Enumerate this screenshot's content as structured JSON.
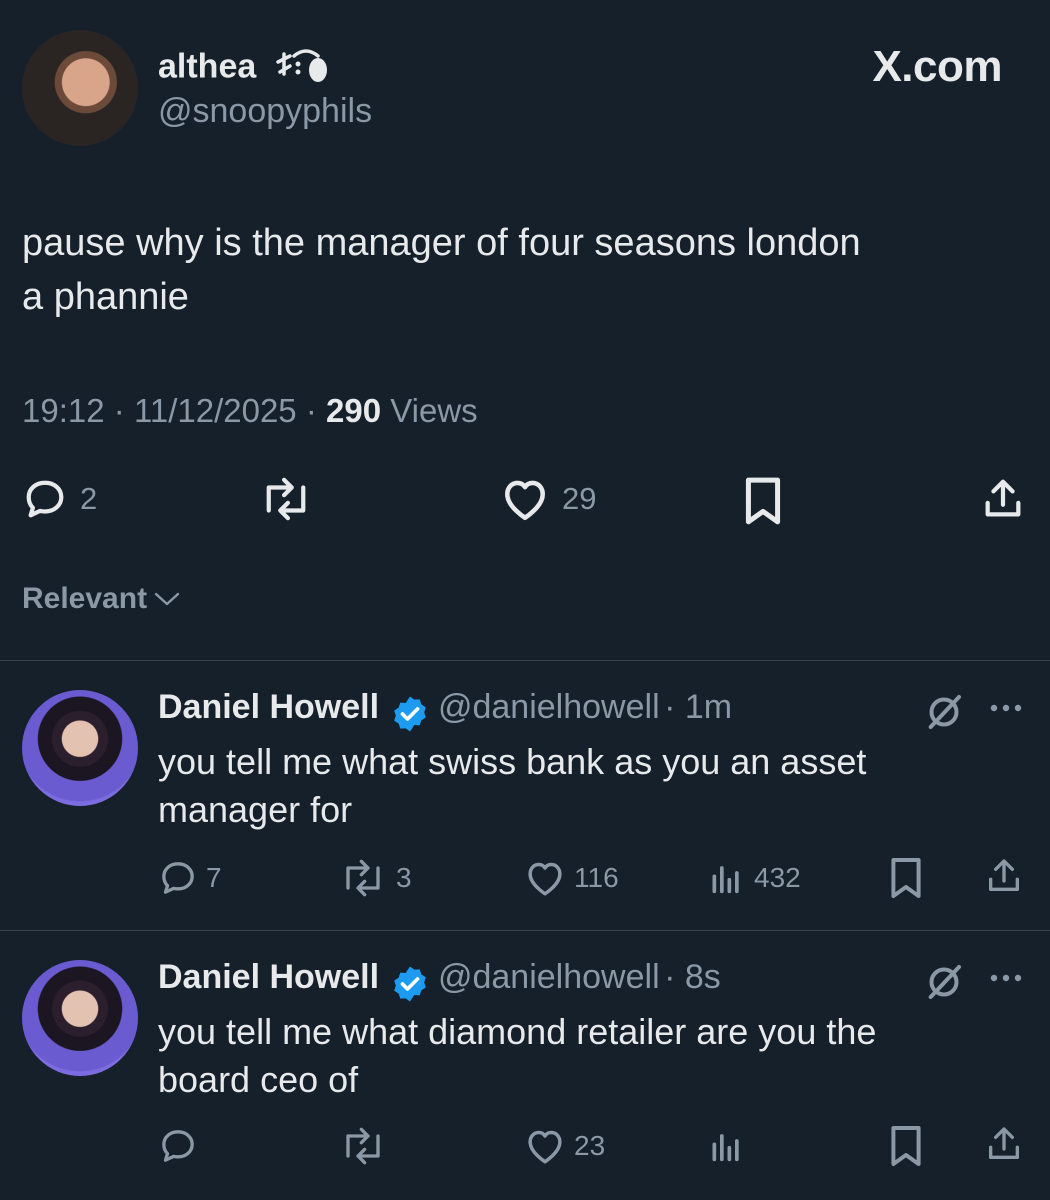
{
  "main_tweet": {
    "author_name": "althea",
    "author_handle": "@snoopyphils",
    "brand": "X.com",
    "text_line1": "pause why is the manager of four seasons london",
    "text_line2": "a phannie",
    "time": "19:12",
    "date": "11/12/2025",
    "views_count": "290",
    "views_label": "Views",
    "replies": "2",
    "likes": "29"
  },
  "sort": {
    "label": "Relevant"
  },
  "replies": [
    {
      "name": "Daniel Howell",
      "handle": "@danielhowell",
      "time": "1m",
      "text_line1": "you tell me what swiss bank as you an asset",
      "text_line2": "manager for",
      "replies": "7",
      "reposts": "3",
      "likes": "116",
      "views": "432"
    },
    {
      "name": "Daniel Howell",
      "handle": "@danielhowell",
      "time": "8s",
      "text_line1": "you tell me what diamond retailer are you the",
      "text_line2": "board ceo of",
      "replies": "",
      "reposts": "",
      "likes": "23",
      "views": ""
    }
  ],
  "colors": {
    "background": "#15202b",
    "text": "#e7e9ea",
    "muted": "#8b98a5",
    "verified": "#1d9bf0",
    "divider": "#38444d"
  }
}
